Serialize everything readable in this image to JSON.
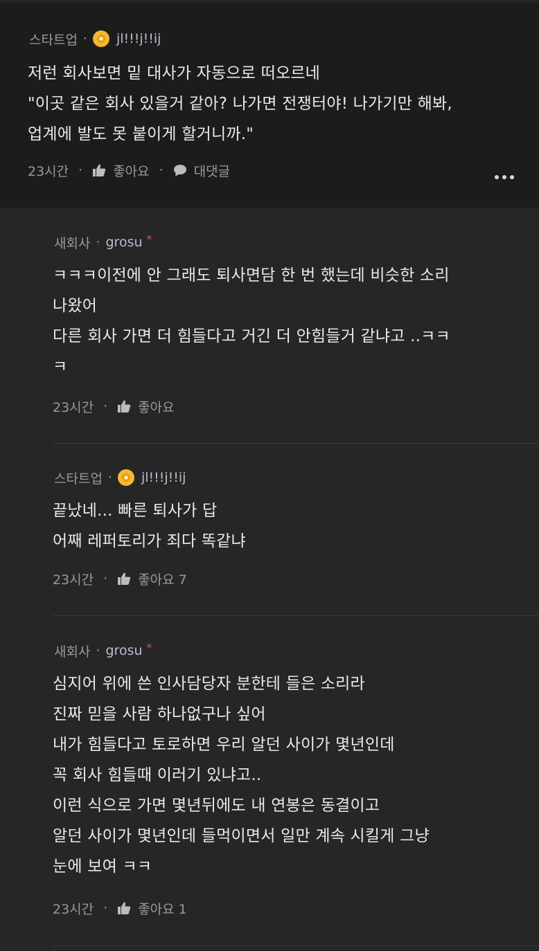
{
  "comments": [
    {
      "company": "스타트업",
      "nickname": "jl!!!j!!ij",
      "body": "저런 회사보면 밑 대사가 자동으로 떠오르네\n\"이곳 같은 회사 있을거 같아? 나가면 전쟁터야! 나가기만 해봐,\n업계에 발도 못 붙이게 할거니까.\"",
      "time": "23시간",
      "like_label": "좋아요",
      "reply_label": "대댓글"
    },
    {
      "company": "새회사",
      "nickname": "grosu",
      "author_mark": "*",
      "body": "ㅋㅋㅋ이전에 안 그래도 퇴사면담 한 번 했는데 비슷한 소리\n나왔어\n다른 회사 가면 더 힘들다고 거긴 더 안힘들거 같냐고 ..ㅋㅋ\nㅋ",
      "time": "23시간",
      "like_label": "좋아요"
    },
    {
      "company": "스타트업",
      "nickname": "jl!!!j!!ij",
      "body": "끝났네... 빠른 퇴사가 답\n어째 레퍼토리가 죄다 똑같냐",
      "time": "23시간",
      "like_label": "좋아요 7"
    },
    {
      "company": "새회사",
      "nickname": "grosu",
      "author_mark": "*",
      "body": "심지어 위에 쓴 인사담당자 분한테 들은 소리라\n진짜 믿을 사람 하나없구나 싶어\n내가 힘들다고 토로하면 우리 알던 사이가 몇년인데\n꼭 회사 힘들때 이러기 있냐고..\n이런 식으로 가면 몇년뒤에도 내 연봉은 동결이고\n알던 사이가 몇년인데 들먹이면서 일만 계속 시킬게 그냥\n눈에 보여 ㅋㅋ",
      "time": "23시간",
      "like_label": "좋아요 1"
    }
  ],
  "separator": "·",
  "icons": {
    "badge": "flower-badge-icon",
    "like": "thumbs-up-icon",
    "reply": "speech-bubble-icon",
    "more": "more-dots-icon"
  },
  "colors": {
    "background": "#252525",
    "main_comment_bg": "#1c1c1c",
    "badge": "#f4b731",
    "author_mark": "#e14d4d"
  }
}
